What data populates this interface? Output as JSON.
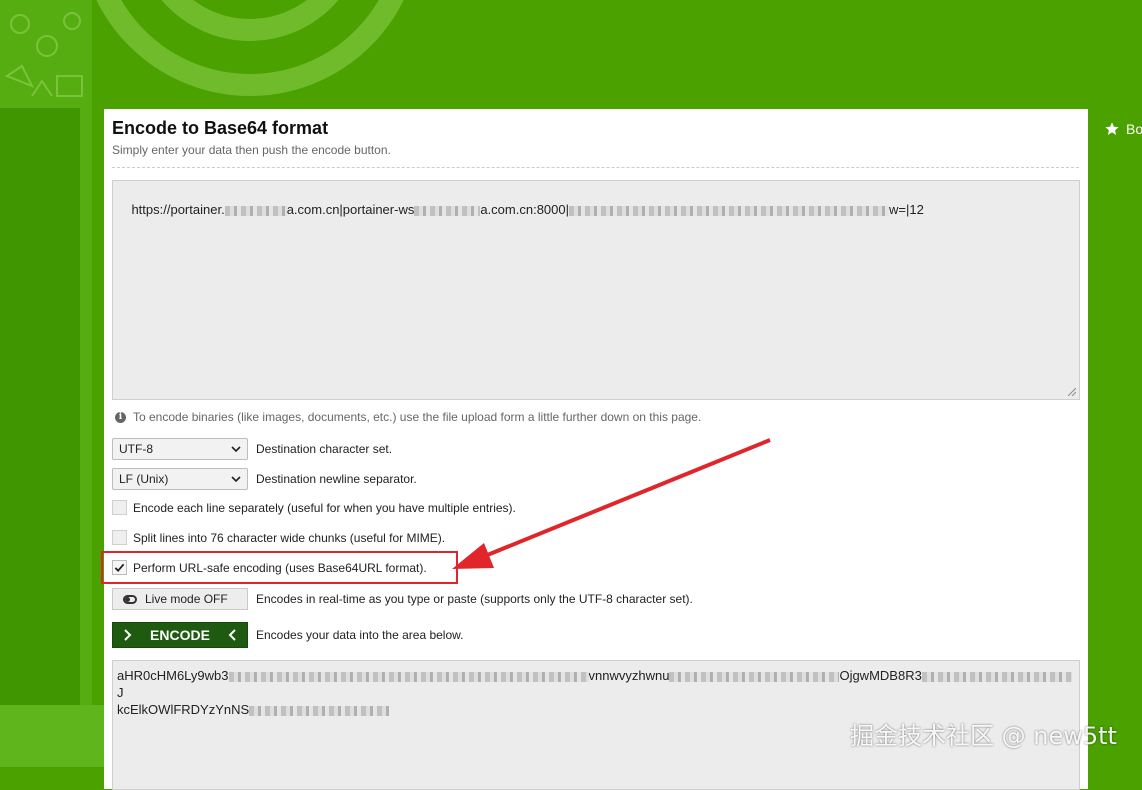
{
  "bookmark": {
    "label": "Bo"
  },
  "page": {
    "title": "Encode to Base64 format",
    "subtitle": "Simply enter your data then push the encode button."
  },
  "input": {
    "value_part1": "https://portainer.",
    "value_part2": "a.com.cn|portainer-ws",
    "value_part3": "a.com.cn:8000|",
    "value_part4": "w=|12"
  },
  "info_text": "To encode binaries (like images, documents, etc.) use the file upload form a little further down on this page.",
  "charset": {
    "value": "UTF-8",
    "label": "Destination character set."
  },
  "newline": {
    "value": "LF (Unix)",
    "label": "Destination newline separator."
  },
  "options": {
    "each_line": {
      "label": "Encode each line separately (useful for when you have multiple entries).",
      "checked": false
    },
    "split_lines": {
      "label": "Split lines into 76 character wide chunks (useful for MIME).",
      "checked": false
    },
    "url_safe": {
      "label": "Perform URL-safe encoding (uses Base64URL format).",
      "checked": true
    }
  },
  "live_mode": {
    "button_label": "Live mode OFF",
    "label": "Encodes in real-time as you type or paste (supports only the UTF-8 character set)."
  },
  "encode": {
    "button_label": "ENCODE",
    "label": "Encodes your data into the area below."
  },
  "output": {
    "line1_start": "aHR0cHM6Ly9wb3",
    "line1_mid": "vnnwvyzhwnu",
    "line1_mid2": "OjgwMDB8R3",
    "line1_end": "J",
    "line2_start": "kcElkOWlFRDYzYnNS"
  },
  "watermark": "掘金技术社区 @ new5tt",
  "colors": {
    "background_green": "#4aa100",
    "encode_button": "#1e5a0f",
    "annotation_red": "#e0262b"
  }
}
